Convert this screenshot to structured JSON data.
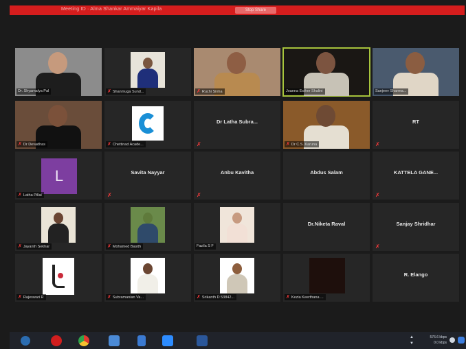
{
  "window": {
    "title_bar_text": "Meeting ID  ·  Alma Shankar Ammaiyar Kapila",
    "title_bar_button": "Stop Share"
  },
  "participants": [
    {
      "name": "Dr. Shyamalya Pal",
      "display": "label",
      "muted": false,
      "video": true
    },
    {
      "name": "Shanmuga Sund...",
      "display": "label",
      "muted": true,
      "video": true
    },
    {
      "name": "Ruchi Sinha",
      "display": "label",
      "muted": true,
      "video": true
    },
    {
      "name": "Joanna Esther Shalini",
      "display": "label",
      "muted": false,
      "video": true,
      "active_speaker": true
    },
    {
      "name": "Sanjeev Sharma...",
      "display": "label",
      "muted": false,
      "video": true
    },
    {
      "name": "Dr Devadhas",
      "display": "label",
      "muted": true,
      "video": true
    },
    {
      "name": "Chettinad Acade...",
      "display": "label",
      "muted": true,
      "video": true
    },
    {
      "name": "Dr Latha Subra...",
      "display": "center",
      "muted": true,
      "video": false
    },
    {
      "name": "Dr C.S. Karuna",
      "display": "label",
      "muted": true,
      "video": true
    },
    {
      "name": "RT",
      "display": "center",
      "muted": true,
      "video": false
    },
    {
      "name": "Latha Pillai",
      "display": "label",
      "muted": true,
      "video": false,
      "avatar_letter": "L"
    },
    {
      "name": "Savita Nayyar",
      "display": "center",
      "muted": true,
      "video": false
    },
    {
      "name": "Anbu Kavitha",
      "display": "center",
      "muted": true,
      "video": false
    },
    {
      "name": "Abdus Salam",
      "display": "center",
      "muted": false,
      "video": false
    },
    {
      "name": "KATTELA GANE...",
      "display": "center",
      "muted": true,
      "video": false
    },
    {
      "name": "Jayanth Sekhar",
      "display": "label",
      "muted": true,
      "video": true
    },
    {
      "name": "Mohamed Basith",
      "display": "label",
      "muted": true,
      "video": true
    },
    {
      "name": "Fazila S F",
      "display": "label",
      "muted": false,
      "video": true
    },
    {
      "name": "Dr.Niketa Raval",
      "display": "center",
      "muted": false,
      "video": false
    },
    {
      "name": "Sanjay Shridhar",
      "display": "center",
      "muted": true,
      "video": false
    },
    {
      "name": "Rajeswari R",
      "display": "label",
      "muted": true,
      "video": true
    },
    {
      "name": "Subramanian Va...",
      "display": "label",
      "muted": true,
      "video": true
    },
    {
      "name": "Srikanth D 53842...",
      "display": "label",
      "muted": true,
      "video": true
    },
    {
      "name": "Kezia Keerthana ...",
      "display": "label",
      "muted": true,
      "video": true
    },
    {
      "name": "R. Elango",
      "display": "center",
      "muted": false,
      "video": false
    }
  ],
  "taskbar": {
    "apps": [
      "start-icon",
      "opera-icon",
      "chrome-icon",
      "photos-icon",
      "file-icon",
      "zoom-icon",
      "word-icon"
    ],
    "upload": "576.6 kbps",
    "download": "0.0 kbps"
  },
  "colors": {
    "accent_red": "#d51d1d",
    "active_border": "#a7c43c",
    "mute_red": "#ff3b3b",
    "tile_bg": "#262626"
  }
}
